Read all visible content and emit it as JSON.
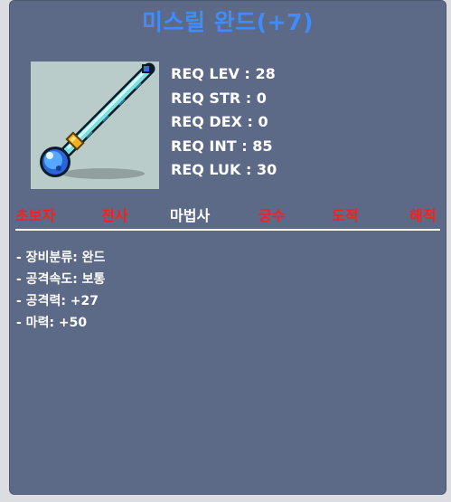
{
  "item": {
    "name": "미스릴 완드(+7)",
    "name_color": "#3f8cff",
    "icon": "mithril-wand-icon"
  },
  "requirements": [
    {
      "label": "REQ LEV",
      "value": "28",
      "text": "REQ LEV : 28"
    },
    {
      "label": "REQ STR",
      "value": "0",
      "text": "REQ STR : 0"
    },
    {
      "label": "REQ DEX",
      "value": "0",
      "text": "REQ DEX : 0"
    },
    {
      "label": "REQ INT",
      "value": "85",
      "text": "REQ INT : 85"
    },
    {
      "label": "REQ LUK",
      "value": "30",
      "text": "REQ LUK : 30"
    }
  ],
  "jobs": [
    {
      "name": "초보자",
      "usable": false,
      "color": "#ff1c1c"
    },
    {
      "name": "전사",
      "usable": false,
      "color": "#ff1c1c"
    },
    {
      "name": "마법사",
      "usable": true,
      "color": "#ffffff"
    },
    {
      "name": "궁수",
      "usable": false,
      "color": "#ff1c1c"
    },
    {
      "name": "도적",
      "usable": false,
      "color": "#ff1c1c"
    },
    {
      "name": "해적",
      "usable": false,
      "color": "#ff1c1c"
    }
  ],
  "stats": [
    "- 장비분류: 완드",
    "- 공격속도: 보통",
    "- 공격력: +27",
    "- 마력: +50"
  ],
  "colors": {
    "panel_bg": "#5c6a87",
    "icon_bg": "#b9ccc9",
    "unusable": "#ff1c1c",
    "usable": "#ffffff"
  }
}
